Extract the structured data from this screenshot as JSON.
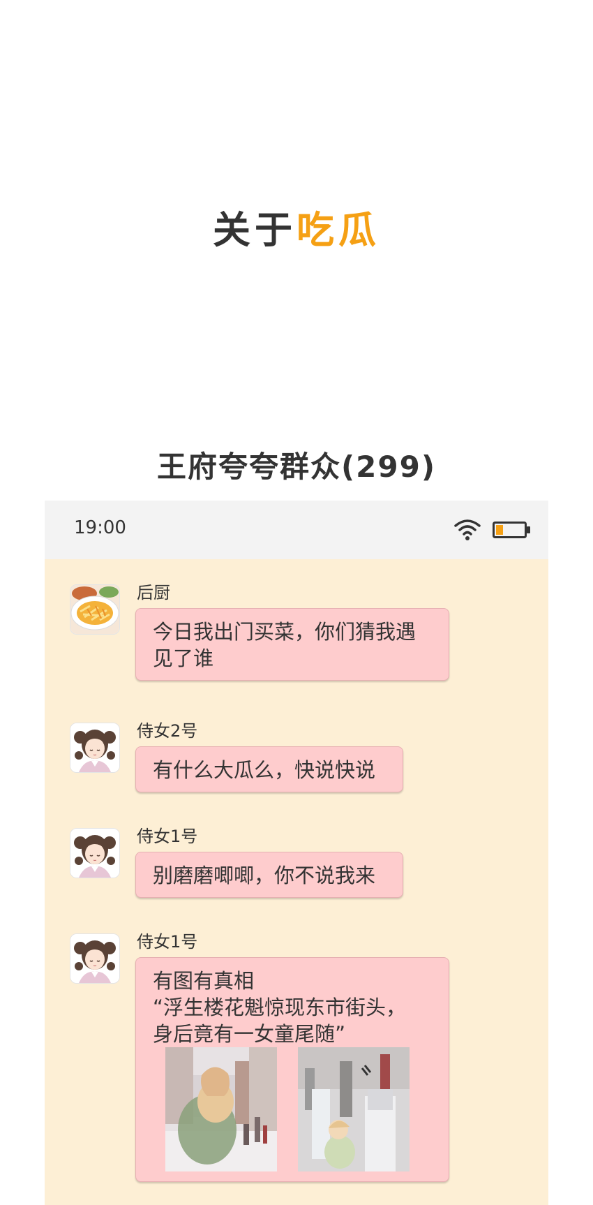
{
  "heading": {
    "part_a": "关于",
    "part_b": "吃瓜"
  },
  "group_title": "王府夸夸群众(299)",
  "status_bar": {
    "time": "19:00",
    "wifi_icon": "wifi-icon",
    "battery_icon": "battery-low-icon"
  },
  "colors": {
    "accent": "#f5a014",
    "chat_background": "#fdefd5",
    "bubble": "#fecccd",
    "status_bar": "#f3f3f3"
  },
  "messages": [
    {
      "sender": "后厨",
      "avatar": "food-plate-avatar",
      "lines": [
        "今日我出门买菜，你们猜我遇",
        "见了谁"
      ]
    },
    {
      "sender": "侍女2号",
      "avatar": "maid-avatar",
      "lines": [
        "有什么大瓜么，快说快说"
      ]
    },
    {
      "sender": "侍女1号",
      "avatar": "maid-avatar",
      "lines": [
        "别磨磨唧唧，你不说我来"
      ]
    },
    {
      "sender": "侍女1号",
      "avatar": "maid-avatar",
      "lines": [
        "有图有真相",
        "“浮生楼花魁惊现东市街头，",
        "身后竟有一女童尾随”"
      ],
      "images": [
        "street-scene-photo",
        "street-scene-photo"
      ]
    }
  ]
}
